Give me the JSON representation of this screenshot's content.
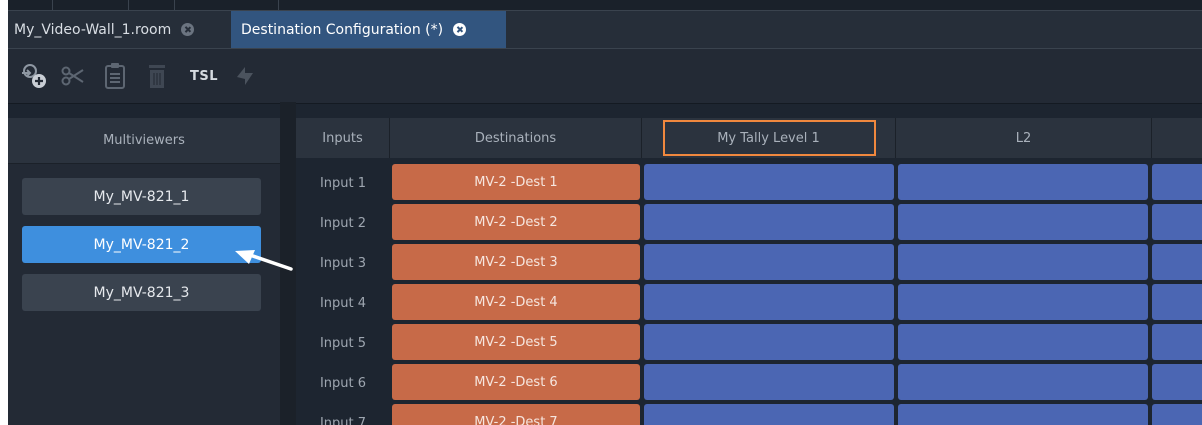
{
  "tabs": [
    {
      "label": "My_Video-Wall_1.room",
      "active": false
    },
    {
      "label": "Destination Configuration (*)",
      "active": true
    }
  ],
  "toolbar": {
    "icons": [
      "add-destination-icon",
      "scissors-icon",
      "clipboard-icon",
      "trash-icon",
      "tsl-button",
      "refresh-icon"
    ],
    "tsl_label": "TSL"
  },
  "multiviewers": {
    "header": "Multiviewers",
    "items": [
      {
        "label": "My_MV-821_1",
        "selected": false
      },
      {
        "label": "My_MV-821_2",
        "selected": true
      },
      {
        "label": "My_MV-821_3",
        "selected": false
      }
    ]
  },
  "grid": {
    "columns": {
      "inputs": "Inputs",
      "destinations": "Destinations",
      "tally1": "My Tally Level 1",
      "tally2": "L2"
    },
    "rows": [
      {
        "input": "Input 1",
        "destination": "MV-2 -Dest 1"
      },
      {
        "input": "Input 2",
        "destination": "MV-2 -Dest 2"
      },
      {
        "input": "Input 3",
        "destination": "MV-2 -Dest 3"
      },
      {
        "input": "Input 4",
        "destination": "MV-2 -Dest 4"
      },
      {
        "input": "Input 5",
        "destination": "MV-2 -Dest 5"
      },
      {
        "input": "Input 6",
        "destination": "MV-2 -Dest 6"
      },
      {
        "input": "Input 7",
        "destination": "MV-2 -Dest 7"
      }
    ]
  },
  "colors": {
    "destination_cell": "#c76a48",
    "tally_cell": "#4b66b3",
    "selected_item": "#3e8fde",
    "highlight_border": "#f0883e"
  }
}
